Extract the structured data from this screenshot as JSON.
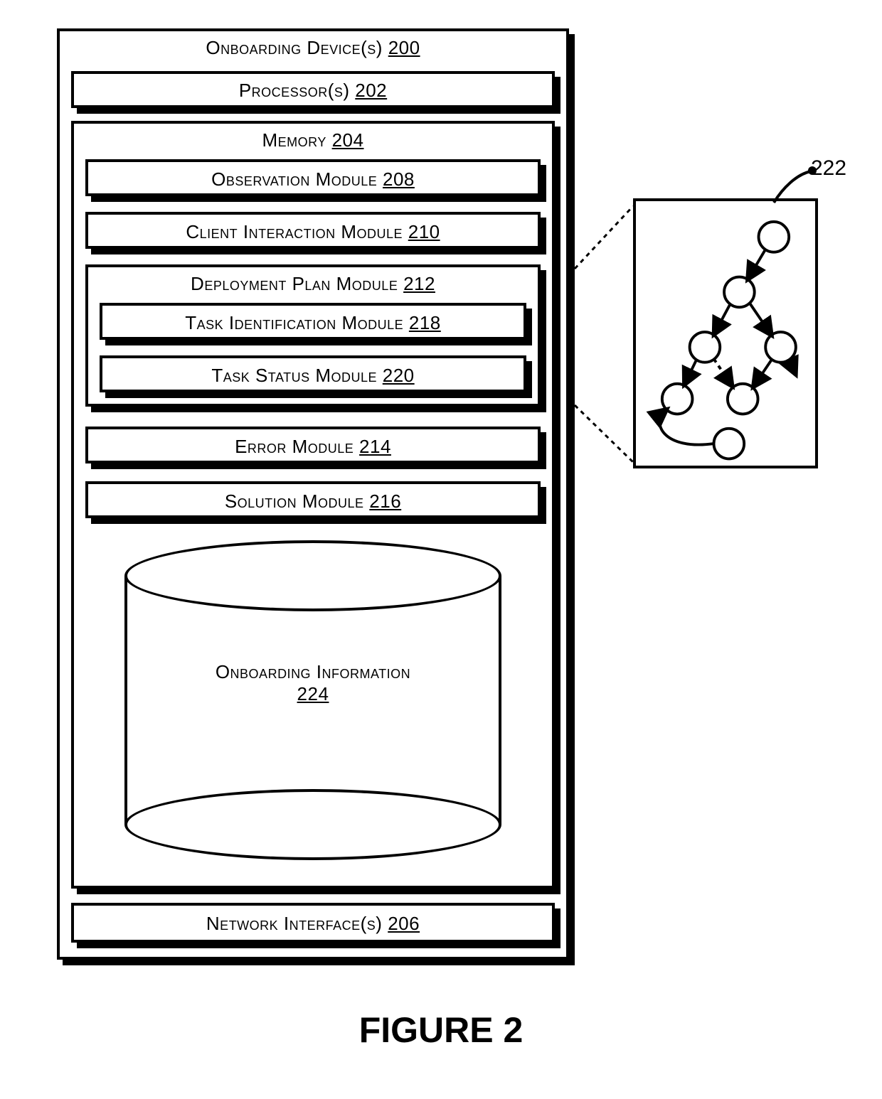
{
  "outer": {
    "title": "Onboarding Device(s)",
    "num": "200"
  },
  "processor": {
    "title": "Processor(s)",
    "num": "202"
  },
  "memory": {
    "title": "Memory",
    "num": "204"
  },
  "observation": {
    "title": "Observation Module",
    "num": "208"
  },
  "client": {
    "title": "Client Interaction Module",
    "num": "210"
  },
  "deployment": {
    "title": "Deployment Plan Module",
    "num": "212"
  },
  "task_id": {
    "title": "Task Identification Module",
    "num": "218"
  },
  "task_status": {
    "title": "Task Status Module",
    "num": "220"
  },
  "error": {
    "title": "Error Module",
    "num": "214"
  },
  "solution": {
    "title": "Solution Module",
    "num": "216"
  },
  "cylinder": {
    "line1": "Onboarding Information",
    "num": "224"
  },
  "network": {
    "title": "Network Interface(s)",
    "num": "206"
  },
  "callout": {
    "num": "222"
  },
  "figure": "FIGURE 2"
}
